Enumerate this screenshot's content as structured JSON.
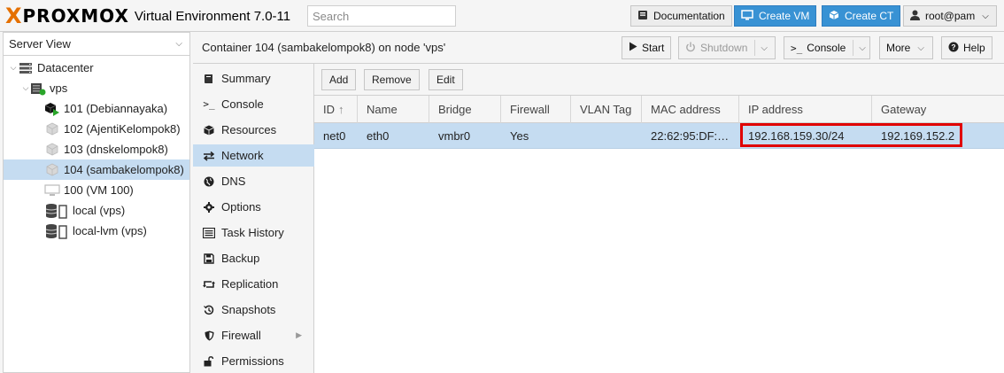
{
  "topbar": {
    "logo_x": "X",
    "logo_text": "PROXMOX",
    "logo_sub": "Virtual Environment 7.0-11",
    "search_placeholder": "Search",
    "documentation": "Documentation",
    "create_vm": "Create VM",
    "create_ct": "Create CT",
    "user": "root@pam"
  },
  "tree": {
    "view": "Server View",
    "items": [
      {
        "label": "Datacenter",
        "icon": "datacenter-icon"
      },
      {
        "label": "vps",
        "icon": "node-icon"
      },
      {
        "label": "101 (Debiannayaka)",
        "icon": "container-running-icon"
      },
      {
        "label": "102 (AjentiKelompok8)",
        "icon": "container-icon"
      },
      {
        "label": "103 (dnskelompok8)",
        "icon": "container-icon"
      },
      {
        "label": "104 (sambakelompok8)",
        "icon": "container-icon"
      },
      {
        "label": "100 (VM 100)",
        "icon": "vm-icon"
      },
      {
        "label": "local (vps)",
        "icon": "storage-icon"
      },
      {
        "label": "local-lvm (vps)",
        "icon": "storage-icon"
      }
    ]
  },
  "header": {
    "title": "Container 104 (sambakelompok8) on node 'vps'",
    "start": "Start",
    "shutdown": "Shutdown",
    "console": "Console",
    "more": "More",
    "help": "Help"
  },
  "submenu": {
    "items": [
      {
        "label": "Summary",
        "icon": "book-icon"
      },
      {
        "label": "Console",
        "icon": "terminal-icon"
      },
      {
        "label": "Resources",
        "icon": "cube-icon"
      },
      {
        "label": "Network",
        "icon": "exchange-icon"
      },
      {
        "label": "DNS",
        "icon": "globe-icon"
      },
      {
        "label": "Options",
        "icon": "gear-icon"
      },
      {
        "label": "Task History",
        "icon": "list-icon"
      },
      {
        "label": "Backup",
        "icon": "floppy-icon"
      },
      {
        "label": "Replication",
        "icon": "retweet-icon"
      },
      {
        "label": "Snapshots",
        "icon": "history-icon"
      },
      {
        "label": "Firewall",
        "icon": "shield-icon"
      },
      {
        "label": "Permissions",
        "icon": "unlock-icon"
      }
    ]
  },
  "grid": {
    "toolbar": {
      "add": "Add",
      "remove": "Remove",
      "edit": "Edit"
    },
    "columns": [
      "ID",
      "Name",
      "Bridge",
      "Firewall",
      "VLAN Tag",
      "MAC address",
      "IP address",
      "Gateway"
    ],
    "sort_indicator": "↑",
    "rows": [
      {
        "id": "net0",
        "name": "eth0",
        "bridge": "vmbr0",
        "firewall": "Yes",
        "vlan": "",
        "mac": "22:62:95:DF:…",
        "ip": "192.168.159.30/24",
        "gateway": "192.169.152.2"
      }
    ]
  },
  "colors": {
    "accent": "#3892d4",
    "logo_orange": "#e57000",
    "selection": "#c5dcf1",
    "highlight_box": "#e00000"
  }
}
